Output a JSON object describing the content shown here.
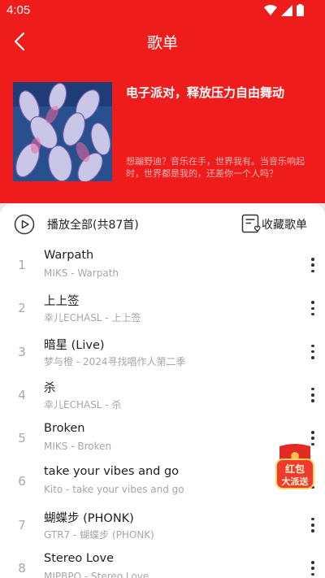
{
  "status_bar": {
    "time": "4:05"
  },
  "nav": {
    "title": "歌单"
  },
  "playlist": {
    "name": "电子派对，释放压力自由舞动",
    "description": "想蹦野迪？音乐在手，世界我有。当音乐响起时，世界都是我的，还差你一个人吗？"
  },
  "actions": {
    "play_all": "播放全部(共87首)",
    "collect": "收藏歌单"
  },
  "songs": [
    {
      "index": "1",
      "title": "Warpath",
      "subtitle": "MIKS - Warpath"
    },
    {
      "index": "2",
      "title": "上上签",
      "subtitle": "幸儿ECHASL - 上上签"
    },
    {
      "index": "3",
      "title": "暗星 (Live)",
      "subtitle": "梦与橙 - 2024寻找唱作人第二季"
    },
    {
      "index": "4",
      "title": "杀",
      "subtitle": "幸儿ECHASL - 杀"
    },
    {
      "index": "5",
      "title": "Broken",
      "subtitle": "MIKS - Broken"
    },
    {
      "index": "6",
      "title": "take your vibes and go",
      "subtitle": "Kito - take your vibes and go"
    },
    {
      "index": "7",
      "title": "蝴蝶步 (PHONK)",
      "subtitle": "GTR7 - 蝴蝶步 (PHONK)"
    },
    {
      "index": "8",
      "title": "Stereo Love",
      "subtitle": "MIPBPO - Stereo Love"
    }
  ],
  "floating": {
    "line1": "红包",
    "line2": "大派送"
  },
  "colors": {
    "brand_red": "#ef1c1c",
    "description_text": "#f6b5b5",
    "index_gray": "#a8a8a8"
  }
}
